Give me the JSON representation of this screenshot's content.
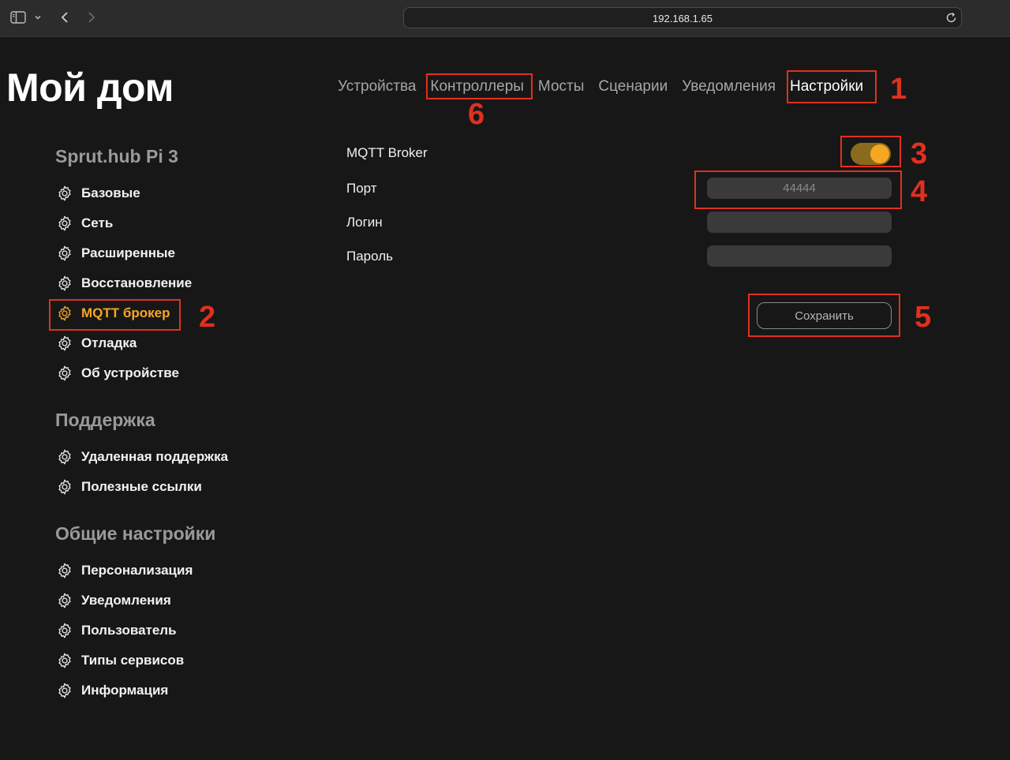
{
  "browser": {
    "url": "192.168.1.65"
  },
  "title": "Мой дом",
  "topnav": {
    "tabs": [
      {
        "label": "Устройства"
      },
      {
        "label": "Контроллеры"
      },
      {
        "label": "Мосты"
      },
      {
        "label": "Сценарии"
      },
      {
        "label": "Уведомления"
      },
      {
        "label": "Настройки",
        "active": true
      }
    ]
  },
  "sidebar": {
    "sections": [
      {
        "title": "Sprut.hub Pi 3",
        "items": [
          {
            "label": "Базовые"
          },
          {
            "label": "Сеть"
          },
          {
            "label": "Расширенные"
          },
          {
            "label": "Восстановление"
          },
          {
            "label": "MQTT брокер",
            "active": true
          },
          {
            "label": "Отладка"
          },
          {
            "label": "Об устройстве"
          }
        ]
      },
      {
        "title": "Поддержка",
        "items": [
          {
            "label": "Удаленная поддержка"
          },
          {
            "label": "Полезные ссылки"
          }
        ]
      },
      {
        "title": "Общие настройки",
        "items": [
          {
            "label": "Персонализация"
          },
          {
            "label": "Уведомления"
          },
          {
            "label": "Пользователь"
          },
          {
            "label": "Типы сервисов"
          },
          {
            "label": "Информация"
          }
        ]
      }
    ]
  },
  "form": {
    "broker_label": "MQTT Broker",
    "broker_enabled": true,
    "port_label": "Порт",
    "port_placeholder": "44444",
    "port_value": "",
    "login_label": "Логин",
    "login_value": "",
    "password_label": "Пароль",
    "password_value": "",
    "save_label": "Сохранить"
  },
  "annotations": {
    "n1": "1",
    "n2": "2",
    "n3": "3",
    "n4": "4",
    "n5": "5",
    "n6": "6"
  },
  "colors": {
    "background": "#171717",
    "accent": "#f5a623",
    "annotation": "#e0301e"
  }
}
